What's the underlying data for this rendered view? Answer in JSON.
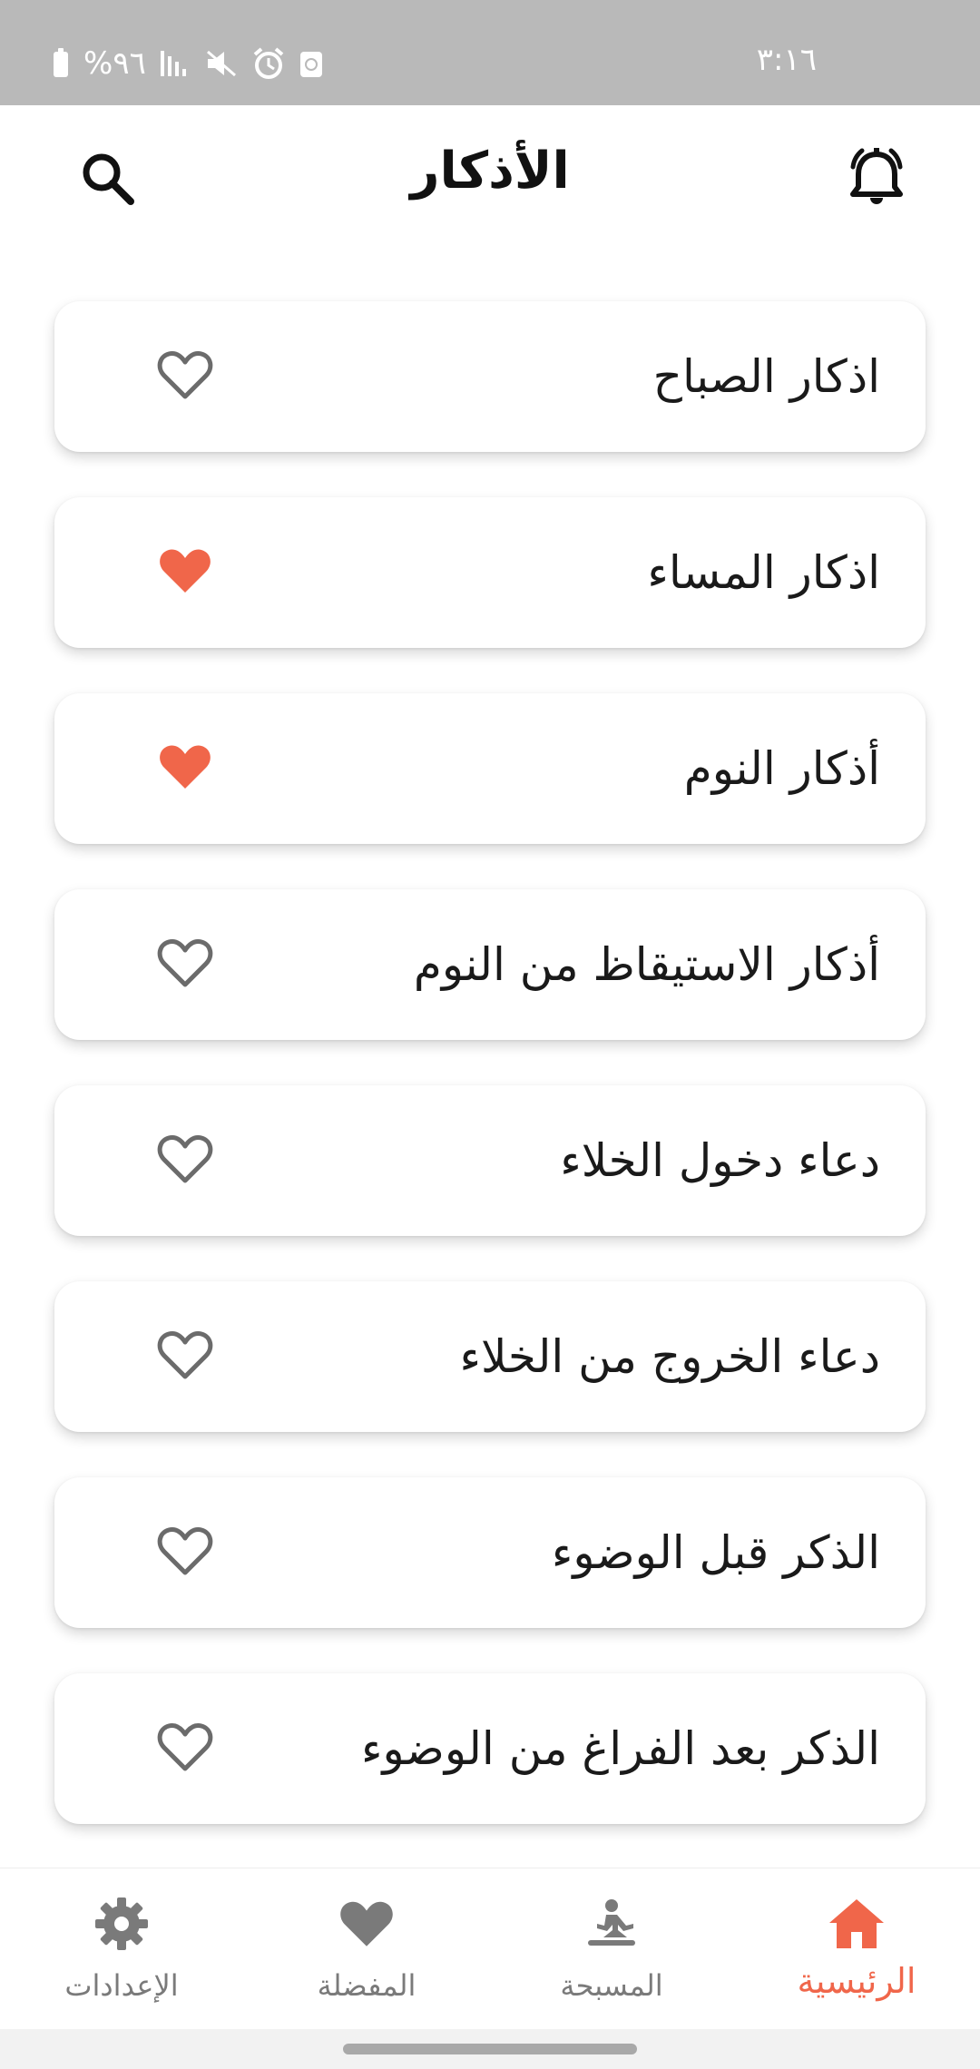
{
  "status_bar": {
    "time": "٣:١٦",
    "battery_percent": "%٩٦",
    "icons": [
      "battery-icon",
      "signal-icon",
      "mute-icon",
      "alarm-icon",
      "recycle-icon"
    ]
  },
  "header": {
    "title": "الأذكار",
    "left_icon": "search-icon",
    "right_icon": "bell-icon"
  },
  "colors": {
    "accent": "#f0664a",
    "heart_outline": "#6b6b6b",
    "nav_inactive": "#7a7a7a"
  },
  "items": [
    {
      "label": "اذكار الصباح",
      "favorite": false
    },
    {
      "label": "اذكار المساء",
      "favorite": true
    },
    {
      "label": "أذكار النوم",
      "favorite": true
    },
    {
      "label": "أذكار الاستيقاظ من النوم",
      "favorite": false
    },
    {
      "label": "دعاء دخول الخلاء",
      "favorite": false
    },
    {
      "label": "دعاء الخروج من الخلاء",
      "favorite": false
    },
    {
      "label": "الذكر قبل الوضوء",
      "favorite": false
    },
    {
      "label": "الذكر بعد الفراغ من الوضوء",
      "favorite": false
    }
  ],
  "bottom_nav": {
    "settings": {
      "label": "الإعدادات",
      "icon": "gear-icon",
      "active": false
    },
    "favorites": {
      "label": "المفضلة",
      "icon": "heart-icon",
      "active": false
    },
    "tasbih": {
      "label": "المسبحة",
      "icon": "meditation-icon",
      "active": false
    },
    "home": {
      "label": "الرئيسية",
      "icon": "home-icon",
      "active": true
    }
  }
}
